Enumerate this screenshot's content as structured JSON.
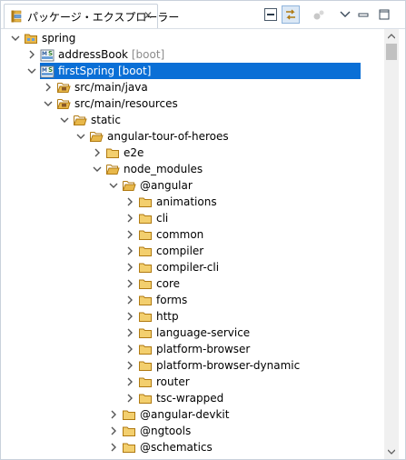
{
  "view": {
    "title": "パッケージ・エクスプローラー",
    "close_glyph": "✕",
    "toolbar": [
      "collapse-all-icon",
      "link-with-editor-icon",
      "focus-task-icon",
      "view-menu-icon",
      "minimize-icon",
      "maximize-icon"
    ]
  },
  "tree": [
    {
      "label": "spring",
      "decoration": "",
      "depth": 0,
      "expander": "expanded",
      "icon": "working-set-icon",
      "selected": false
    },
    {
      "label": "addressBook",
      "decoration": " [boot]",
      "depth": 1,
      "expander": "collapsed",
      "icon": "spring-project-icon",
      "selected": false
    },
    {
      "label": "firstSpring",
      "decoration": " [boot]",
      "depth": 1,
      "expander": "expanded",
      "icon": "spring-project-icon",
      "selected": true
    },
    {
      "label": "src/main/java",
      "decoration": "",
      "depth": 2,
      "expander": "collapsed",
      "icon": "source-folder-icon",
      "selected": false
    },
    {
      "label": "src/main/resources",
      "decoration": "",
      "depth": 2,
      "expander": "expanded",
      "icon": "source-folder-icon",
      "selected": false
    },
    {
      "label": "static",
      "decoration": "",
      "depth": 3,
      "expander": "expanded",
      "icon": "folder-open-icon",
      "selected": false
    },
    {
      "label": "angular-tour-of-heroes",
      "decoration": "",
      "depth": 4,
      "expander": "expanded",
      "icon": "folder-open-icon",
      "selected": false
    },
    {
      "label": "e2e",
      "decoration": "",
      "depth": 5,
      "expander": "collapsed",
      "icon": "folder-icon",
      "selected": false
    },
    {
      "label": "node_modules",
      "decoration": "",
      "depth": 5,
      "expander": "expanded",
      "icon": "folder-open-icon",
      "selected": false
    },
    {
      "label": "@angular",
      "decoration": "",
      "depth": 6,
      "expander": "expanded",
      "icon": "folder-open-icon",
      "selected": false
    },
    {
      "label": "animations",
      "decoration": "",
      "depth": 7,
      "expander": "collapsed",
      "icon": "folder-icon",
      "selected": false
    },
    {
      "label": "cli",
      "decoration": "",
      "depth": 7,
      "expander": "collapsed",
      "icon": "folder-icon",
      "selected": false
    },
    {
      "label": "common",
      "decoration": "",
      "depth": 7,
      "expander": "collapsed",
      "icon": "folder-icon",
      "selected": false
    },
    {
      "label": "compiler",
      "decoration": "",
      "depth": 7,
      "expander": "collapsed",
      "icon": "folder-icon",
      "selected": false
    },
    {
      "label": "compiler-cli",
      "decoration": "",
      "depth": 7,
      "expander": "collapsed",
      "icon": "folder-icon",
      "selected": false
    },
    {
      "label": "core",
      "decoration": "",
      "depth": 7,
      "expander": "collapsed",
      "icon": "folder-icon",
      "selected": false
    },
    {
      "label": "forms",
      "decoration": "",
      "depth": 7,
      "expander": "collapsed",
      "icon": "folder-icon",
      "selected": false
    },
    {
      "label": "http",
      "decoration": "",
      "depth": 7,
      "expander": "collapsed",
      "icon": "folder-icon",
      "selected": false
    },
    {
      "label": "language-service",
      "decoration": "",
      "depth": 7,
      "expander": "collapsed",
      "icon": "folder-icon",
      "selected": false
    },
    {
      "label": "platform-browser",
      "decoration": "",
      "depth": 7,
      "expander": "collapsed",
      "icon": "folder-icon",
      "selected": false
    },
    {
      "label": "platform-browser-dynamic",
      "decoration": "",
      "depth": 7,
      "expander": "collapsed",
      "icon": "folder-icon",
      "selected": false
    },
    {
      "label": "router",
      "decoration": "",
      "depth": 7,
      "expander": "collapsed",
      "icon": "folder-icon",
      "selected": false
    },
    {
      "label": "tsc-wrapped",
      "decoration": "",
      "depth": 7,
      "expander": "collapsed",
      "icon": "folder-icon",
      "selected": false
    },
    {
      "label": "@angular-devkit",
      "decoration": "",
      "depth": 6,
      "expander": "collapsed",
      "icon": "folder-icon",
      "selected": false
    },
    {
      "label": "@ngtools",
      "decoration": "",
      "depth": 6,
      "expander": "collapsed",
      "icon": "folder-icon",
      "selected": false
    },
    {
      "label": "@schematics",
      "decoration": "",
      "depth": 6,
      "expander": "collapsed",
      "icon": "folder-icon",
      "selected": false
    }
  ],
  "colors": {
    "selection": "#0a6fd6",
    "folder": "#e8b84a",
    "folder_stroke": "#b07a12",
    "decoration": "#8c8c8c"
  }
}
